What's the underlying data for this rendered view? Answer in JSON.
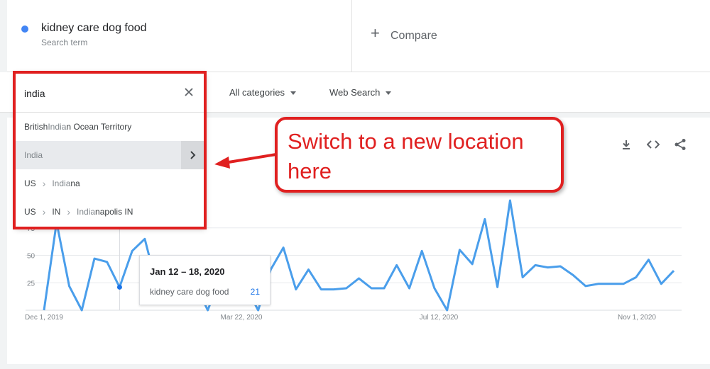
{
  "term": {
    "name": "kidney care dog food",
    "sub": "Search term",
    "color": "#4285f4"
  },
  "compare": {
    "label": "Compare"
  },
  "filters": {
    "category": "All categories",
    "search_type": "Web Search"
  },
  "location_dropdown": {
    "query": "india",
    "items": [
      {
        "parts": [
          "British ",
          "India",
          "n Ocean Territory"
        ]
      },
      {
        "label": "India",
        "active": true
      },
      {
        "parts": [
          "US",
          "India",
          "na"
        ]
      },
      {
        "parts": [
          "US",
          "IN",
          "India",
          "napolis IN"
        ]
      }
    ]
  },
  "callout": {
    "text": "Switch to a new location here",
    "color": "#e02020"
  },
  "tooltip": {
    "date": "Jan 12 – 18, 2020",
    "term": "kidney care dog food",
    "value": "21"
  },
  "chart_data": {
    "type": "line",
    "x_tick_labels": [
      "Dec 1, 2019",
      "Mar 22, 2020",
      "Jul 12, 2020",
      "Nov 1, 2020"
    ],
    "y_tick_labels": [
      "25",
      "50",
      "75"
    ],
    "ylim": [
      0,
      100
    ],
    "series": [
      {
        "color": "#4a9eeb",
        "values": [
          0,
          80,
          22,
          0,
          47,
          44,
          21,
          54,
          65,
          20,
          26,
          20,
          24,
          0,
          30,
          34,
          22,
          0,
          37,
          57,
          19,
          37,
          19,
          19,
          20,
          29,
          20,
          20,
          41,
          20,
          54,
          20,
          0,
          55,
          42,
          83,
          21,
          100,
          30,
          41,
          39,
          40,
          32,
          22,
          24,
          24,
          24,
          30,
          46,
          24,
          36
        ]
      }
    ]
  }
}
